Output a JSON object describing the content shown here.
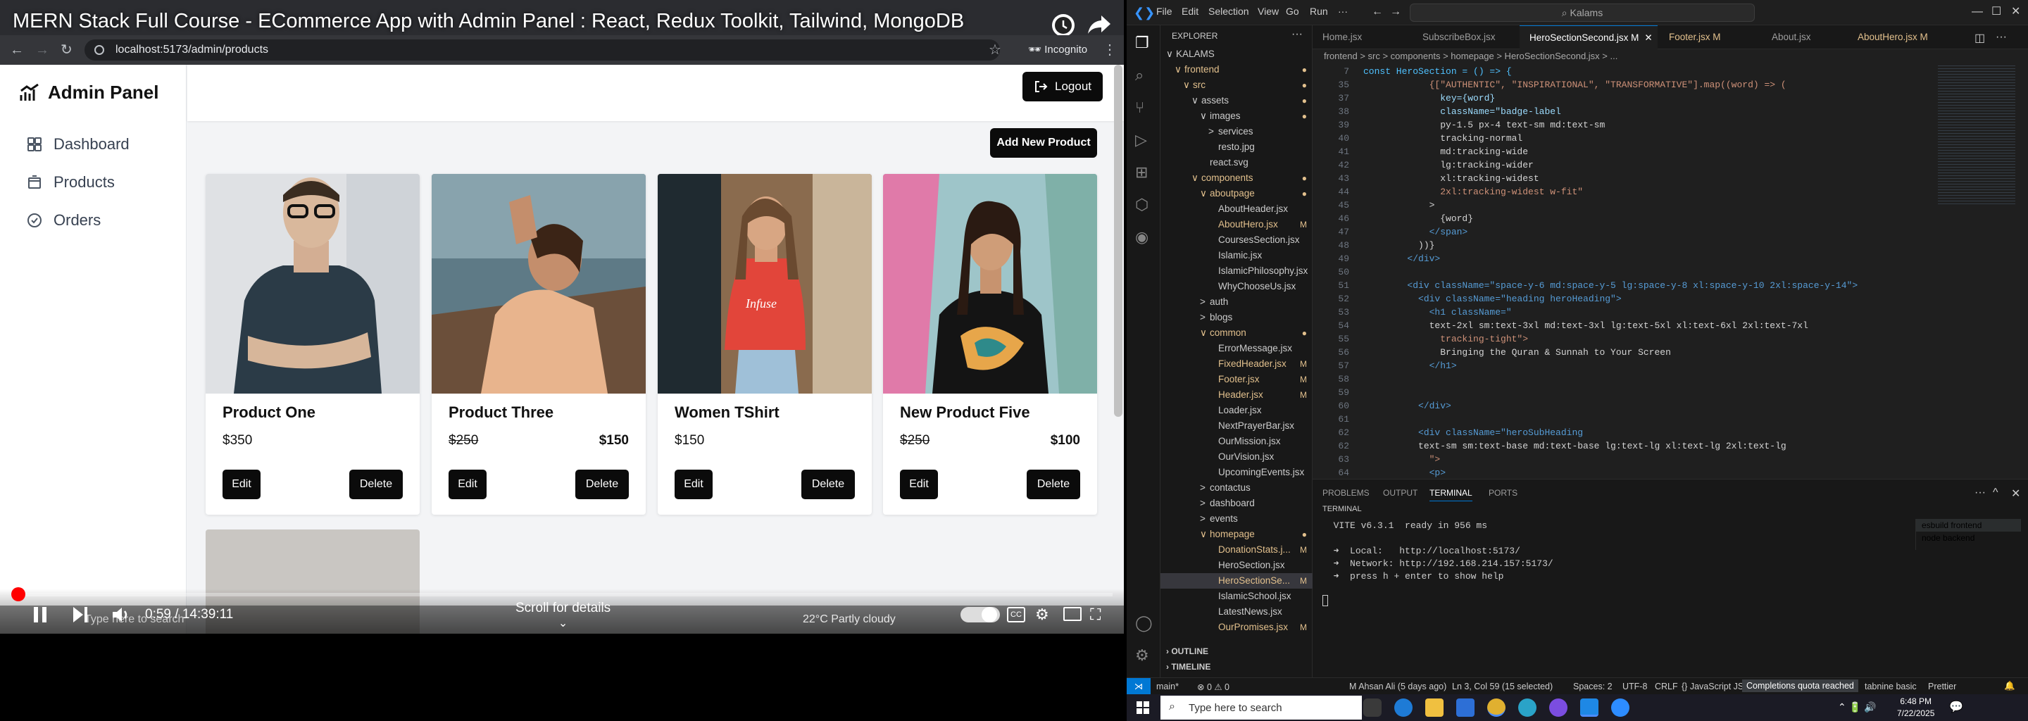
{
  "video": {
    "title": "MERN Stack Full Course - ECommerce App with Admin Panel : React, Redux Toolkit, Tailwind, MongoDB",
    "url": "localhost:5173/admin/products",
    "incognito_label": "Incognito",
    "time": "0:59 / 14:39:11",
    "scroll_hint": "Scroll for details",
    "progress_fraction": 0.0011
  },
  "app": {
    "brand": "Admin Panel",
    "nav": [
      "Dashboard",
      "Products",
      "Orders"
    ],
    "logout_label": "Logout",
    "add_product_label": "Add New Product",
    "edit_label": "Edit",
    "delete_label": "Delete",
    "products": [
      {
        "name": "Product One",
        "price": "$350",
        "sale": ""
      },
      {
        "name": "Product Three",
        "price": "$250",
        "sale": "$150"
      },
      {
        "name": "Women TShirt",
        "price": "$150",
        "sale": ""
      },
      {
        "name": "New Product Five",
        "price": "$250",
        "sale": "$100"
      }
    ]
  },
  "vid_taskbar": {
    "search": "Type here to search",
    "weather": "22°C  Partly cloudy"
  },
  "vscode": {
    "menu": [
      "File",
      "Edit",
      "Selection",
      "View",
      "Go",
      "Run",
      "···"
    ],
    "search": "Kalams",
    "explorer_title": "EXPLORER",
    "tabs": [
      {
        "label": "Home.jsx",
        "active": false
      },
      {
        "label": "SubscribeBox.jsx",
        "active": false
      },
      {
        "label": "HeroSectionSecond.jsx  M",
        "active": true
      },
      {
        "label": "Footer.jsx  M",
        "active": false
      },
      {
        "label": "About.jsx",
        "active": false
      },
      {
        "label": "AboutHero.jsx  M",
        "active": false
      }
    ],
    "breadcrumb": "frontend > src > components > homepage > HeroSectionSecond.jsx > ...",
    "tree": [
      {
        "label": "KALAMS",
        "indent": 0,
        "chev": "∨",
        "mod": false,
        "m": ""
      },
      {
        "label": "frontend",
        "indent": 1,
        "chev": "∨",
        "mod": true,
        "m": "●"
      },
      {
        "label": "src",
        "indent": 2,
        "chev": "∨",
        "mod": true,
        "m": "●"
      },
      {
        "label": "assets",
        "indent": 3,
        "chev": "∨",
        "mod": false,
        "m": "●"
      },
      {
        "label": "images",
        "indent": 4,
        "chev": "∨",
        "mod": false,
        "m": "●"
      },
      {
        "label": "services",
        "indent": 5,
        "chev": ">",
        "mod": false,
        "m": ""
      },
      {
        "label": "resto.jpg",
        "indent": 5,
        "chev": "",
        "mod": false,
        "m": ""
      },
      {
        "label": "react.svg",
        "indent": 4,
        "chev": "",
        "mod": false,
        "m": ""
      },
      {
        "label": "components",
        "indent": 3,
        "chev": "∨",
        "mod": true,
        "m": "●"
      },
      {
        "label": "aboutpage",
        "indent": 4,
        "chev": "∨",
        "mod": true,
        "m": "●"
      },
      {
        "label": "AboutHeader.jsx",
        "indent": 5,
        "chev": "",
        "mod": false,
        "m": ""
      },
      {
        "label": "AboutHero.jsx",
        "indent": 5,
        "chev": "",
        "mod": true,
        "m": "M"
      },
      {
        "label": "CoursesSection.jsx",
        "indent": 5,
        "chev": "",
        "mod": false,
        "m": ""
      },
      {
        "label": "Islamic.jsx",
        "indent": 5,
        "chev": "",
        "mod": false,
        "m": ""
      },
      {
        "label": "IslamicPhilosophy.jsx",
        "indent": 5,
        "chev": "",
        "mod": false,
        "m": ""
      },
      {
        "label": "WhyChooseUs.jsx",
        "indent": 5,
        "chev": "",
        "mod": false,
        "m": ""
      },
      {
        "label": "auth",
        "indent": 4,
        "chev": ">",
        "mod": false,
        "m": ""
      },
      {
        "label": "blogs",
        "indent": 4,
        "chev": ">",
        "mod": false,
        "m": ""
      },
      {
        "label": "common",
        "indent": 4,
        "chev": "∨",
        "mod": true,
        "m": "●"
      },
      {
        "label": "ErrorMessage.jsx",
        "indent": 5,
        "chev": "",
        "mod": false,
        "m": ""
      },
      {
        "label": "FixedHeader.jsx",
        "indent": 5,
        "chev": "",
        "mod": true,
        "m": "M"
      },
      {
        "label": "Footer.jsx",
        "indent": 5,
        "chev": "",
        "mod": true,
        "m": "M"
      },
      {
        "label": "Header.jsx",
        "indent": 5,
        "chev": "",
        "mod": true,
        "m": "M"
      },
      {
        "label": "Loader.jsx",
        "indent": 5,
        "chev": "",
        "mod": false,
        "m": ""
      },
      {
        "label": "NextPrayerBar.jsx",
        "indent": 5,
        "chev": "",
        "mod": false,
        "m": ""
      },
      {
        "label": "OurMission.jsx",
        "indent": 5,
        "chev": "",
        "mod": false,
        "m": ""
      },
      {
        "label": "OurVision.jsx",
        "indent": 5,
        "chev": "",
        "mod": false,
        "m": ""
      },
      {
        "label": "UpcomingEvents.jsx",
        "indent": 5,
        "chev": "",
        "mod": false,
        "m": ""
      },
      {
        "label": "contactus",
        "indent": 4,
        "chev": ">",
        "mod": false,
        "m": ""
      },
      {
        "label": "dashboard",
        "indent": 4,
        "chev": ">",
        "mod": false,
        "m": ""
      },
      {
        "label": "events",
        "indent": 4,
        "chev": ">",
        "mod": false,
        "m": ""
      },
      {
        "label": "homepage",
        "indent": 4,
        "chev": "∨",
        "mod": true,
        "m": "●"
      },
      {
        "label": "DonationStats.j...",
        "indent": 5,
        "chev": "",
        "mod": true,
        "m": "M"
      },
      {
        "label": "HeroSection.jsx",
        "indent": 5,
        "chev": "",
        "mod": false,
        "m": ""
      },
      {
        "label": "HeroSectionSe...",
        "indent": 5,
        "chev": "",
        "mod": true,
        "m": "M",
        "selected": true
      },
      {
        "label": "IslamicSchool.jsx",
        "indent": 5,
        "chev": "",
        "mod": false,
        "m": ""
      },
      {
        "label": "LatestNews.jsx",
        "indent": 5,
        "chev": "",
        "mod": false,
        "m": ""
      },
      {
        "label": "OurPromises.jsx",
        "indent": 5,
        "chev": "",
        "mod": true,
        "m": "M"
      }
    ],
    "outline": "OUTLINE",
    "timeline": "TIMELINE",
    "code": [
      {
        "n": "7",
        "t": "const HeroSection = () => {"
      },
      {
        "n": "35",
        "t": "            {[\"AUTHENTIC\", \"INSPIRATIONAL\", \"TRANSFORMATIVE\"].map((word) => ("
      },
      {
        "n": "37",
        "t": "              key={word}"
      },
      {
        "n": "38",
        "t": "              className=\"badge-label"
      },
      {
        "n": "39",
        "t": "              py-1.5 px-4 text-sm md:text-sm"
      },
      {
        "n": "40",
        "t": "              tracking-normal"
      },
      {
        "n": "41",
        "t": "              md:tracking-wide"
      },
      {
        "n": "42",
        "t": "              lg:tracking-wider"
      },
      {
        "n": "43",
        "t": "              xl:tracking-widest"
      },
      {
        "n": "44",
        "t": "              2xl:tracking-widest w-fit\""
      },
      {
        "n": "45",
        "t": "            >"
      },
      {
        "n": "46",
        "t": "              {word}"
      },
      {
        "n": "47",
        "t": "            </span>"
      },
      {
        "n": "48",
        "t": "          ))}"
      },
      {
        "n": "49",
        "t": "        </div>"
      },
      {
        "n": "50",
        "t": ""
      },
      {
        "n": "51",
        "t": "        <div className=\"space-y-6 md:space-y-5 lg:space-y-8 xl:space-y-10 2xl:space-y-14\">"
      },
      {
        "n": "52",
        "t": "          <div className=\"heading heroHeading\">"
      },
      {
        "n": "53",
        "t": "            <h1 className=\""
      },
      {
        "n": "54",
        "t": "            text-2xl sm:text-3xl md:text-3xl lg:text-5xl xl:text-6xl 2xl:text-7xl"
      },
      {
        "n": "55",
        "t": "              tracking-tight\">"
      },
      {
        "n": "56",
        "t": "              Bringing the Quran & Sunnah to Your Screen"
      },
      {
        "n": "57",
        "t": "            </h1>"
      },
      {
        "n": "58",
        "t": ""
      },
      {
        "n": "59",
        "t": ""
      },
      {
        "n": "60",
        "t": "          </div>"
      },
      {
        "n": "61",
        "t": ""
      },
      {
        "n": "62",
        "t": "          <div className=\"heroSubHeading"
      },
      {
        "n": "62",
        "t": "          text-sm sm:text-base md:text-base lg:text-lg xl:text-lg 2xl:text-lg"
      },
      {
        "n": "63",
        "t": "            \">"
      },
      {
        "n": "64",
        "t": "            <p>"
      }
    ],
    "panel_tabs": [
      "PROBLEMS",
      "OUTPUT",
      "TERMINAL",
      "PORTS"
    ],
    "terminal_header": "TERMINAL",
    "terminal": [
      "  VITE v6.3.1  ready in 956 ms",
      "",
      "  ➜  Local:   http://localhost:5173/",
      "  ➜  Network: http://192.168.214.157:5173/",
      "  ➜  press h + enter to show help"
    ],
    "term_sessions": [
      "esbuild  frontend",
      "node  backend"
    ],
    "status_left": [
      "main*",
      "⊗ 0 ⚠ 0"
    ],
    "status_mid": "M Ahsan Ali (5 days ago)",
    "status_right": [
      "Ln 3, Col 59 (15 selected)",
      "Spaces: 2",
      "UTF-8",
      "CRLF",
      "{} JavaScript JSX",
      "Completions quota reached",
      "tabnine basic",
      "Prettier"
    ]
  },
  "taskbar": {
    "search": "Type here to search",
    "time": "6:48 PM",
    "date": "7/22/2025"
  }
}
